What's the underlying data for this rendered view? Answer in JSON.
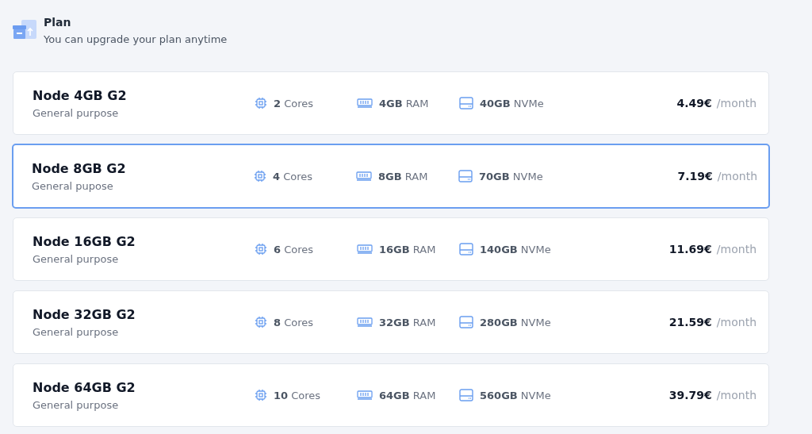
{
  "header": {
    "title": "Plan",
    "subtitle": "You can upgrade your plan anytime"
  },
  "plans": [
    {
      "name": "Node 4GB G2",
      "description": "General purpose",
      "cores": "**2** Cores",
      "ram": "**4GB** RAM",
      "disk": "**40GB** NVMe",
      "price": "4.49€",
      "period": "/month",
      "selected": false
    },
    {
      "name": "Node 8GB G2",
      "description": "General pupose",
      "cores": "**4** Cores",
      "ram": "**8GB** RAM",
      "disk": "**70GB** NVMe",
      "price": "7.19€",
      "period": "/month",
      "selected": true
    },
    {
      "name": "Node 16GB G2",
      "description": "General purpose",
      "cores": "**6** Cores",
      "ram": "**16GB** RAM",
      "disk": "**140GB** NVMe",
      "price": "11.69€",
      "period": "/month",
      "selected": false
    },
    {
      "name": "Node 32GB G2",
      "description": "General purpose",
      "cores": "**8** Cores",
      "ram": "**32GB** RAM",
      "disk": "**280GB** NVMe",
      "price": "21.59€",
      "period": "/month",
      "selected": false
    },
    {
      "name": "Node 64GB G2",
      "description": "General purpose",
      "cores": "**10** Cores",
      "ram": "**64GB** RAM",
      "disk": "**560GB** NVMe",
      "price": "39.79€",
      "period": "/month",
      "selected": false
    }
  ]
}
